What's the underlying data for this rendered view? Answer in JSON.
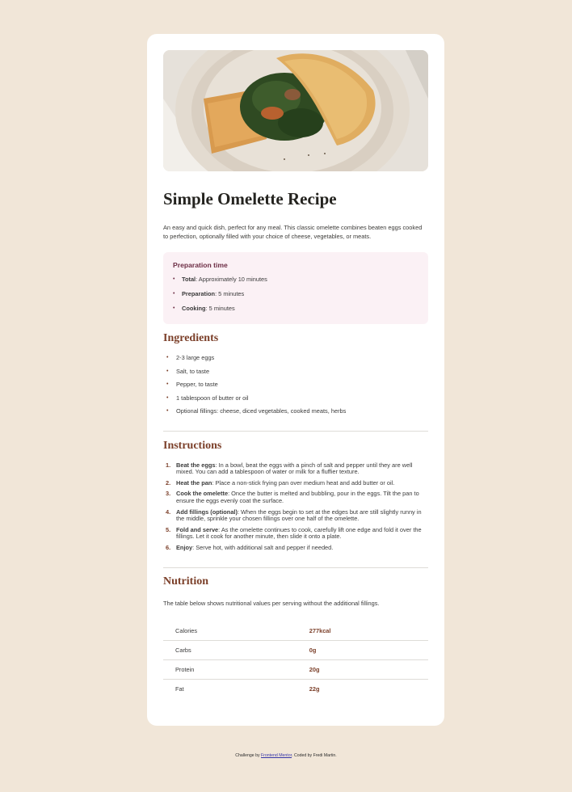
{
  "hero": {
    "alt": "omelette-photo"
  },
  "title": "Simple Omelette Recipe",
  "intro": "An easy and quick dish, perfect for any meal. This classic omelette combines beaten eggs cooked to perfection, optionally filled with your choice of cheese, vegetables, or meats.",
  "preparation": {
    "heading": "Preparation time",
    "items": [
      {
        "label": "Total",
        "text": ": Approximately 10 minutes"
      },
      {
        "label": "Preparation",
        "text": ": 5 minutes"
      },
      {
        "label": "Cooking",
        "text": ": 5 minutes"
      }
    ]
  },
  "ingredients": {
    "heading": "Ingredients",
    "items": [
      "2-3 large eggs",
      "Salt, to taste",
      "Pepper, to taste",
      "1 tablespoon of butter or oil",
      "Optional fillings: cheese, diced vegetables, cooked meats, herbs"
    ]
  },
  "instructions": {
    "heading": "Instructions",
    "items": [
      {
        "num": "1.",
        "label": "Beat the eggs",
        "text": ": In a bowl, beat the eggs with a pinch of salt and pepper until they are well mixed. You can add a tablespoon of water or milk for a fluffier texture."
      },
      {
        "num": "2.",
        "label": "Heat the pan",
        "text": ": Place a non-stick frying pan over medium heat and add butter or oil."
      },
      {
        "num": "3.",
        "label": "Cook the omelette",
        "text": ": Once the butter is melted and bubbling, pour in the eggs. Tilt the pan to ensure the eggs evenly coat the surface."
      },
      {
        "num": "4.",
        "label": "Add fillings (optional)",
        "text": ": When the eggs begin to set at the edges but are still slightly runny in the middle, sprinkle your chosen fillings over one half of the omelette."
      },
      {
        "num": "5.",
        "label": "Fold and serve",
        "text": ": As the omelette continues to cook, carefully lift one edge and fold it over the fillings. Let it cook for another minute, then slide it onto a plate."
      },
      {
        "num": "6.",
        "label": "Enjoy",
        "text": ": Serve hot, with additional salt and pepper if needed."
      }
    ]
  },
  "nutrition": {
    "heading": "Nutrition",
    "description": "The table below shows nutritional values per serving without the additional fillings.",
    "rows": [
      {
        "name": "Calories",
        "value": "277kcal"
      },
      {
        "name": "Carbs",
        "value": "0g"
      },
      {
        "name": "Protein",
        "value": "20g"
      },
      {
        "name": "Fat",
        "value": "22g"
      }
    ]
  },
  "footer": {
    "prefix": "Challenge by ",
    "link": "Frontend Mentor",
    "suffix": ". Coded by Fredi Martin."
  },
  "colors": {
    "background": "#f1e6d8",
    "accent_brown": "#7b3f29",
    "accent_rose": "#6d2e45",
    "prep_bg": "#fbf1f5"
  }
}
